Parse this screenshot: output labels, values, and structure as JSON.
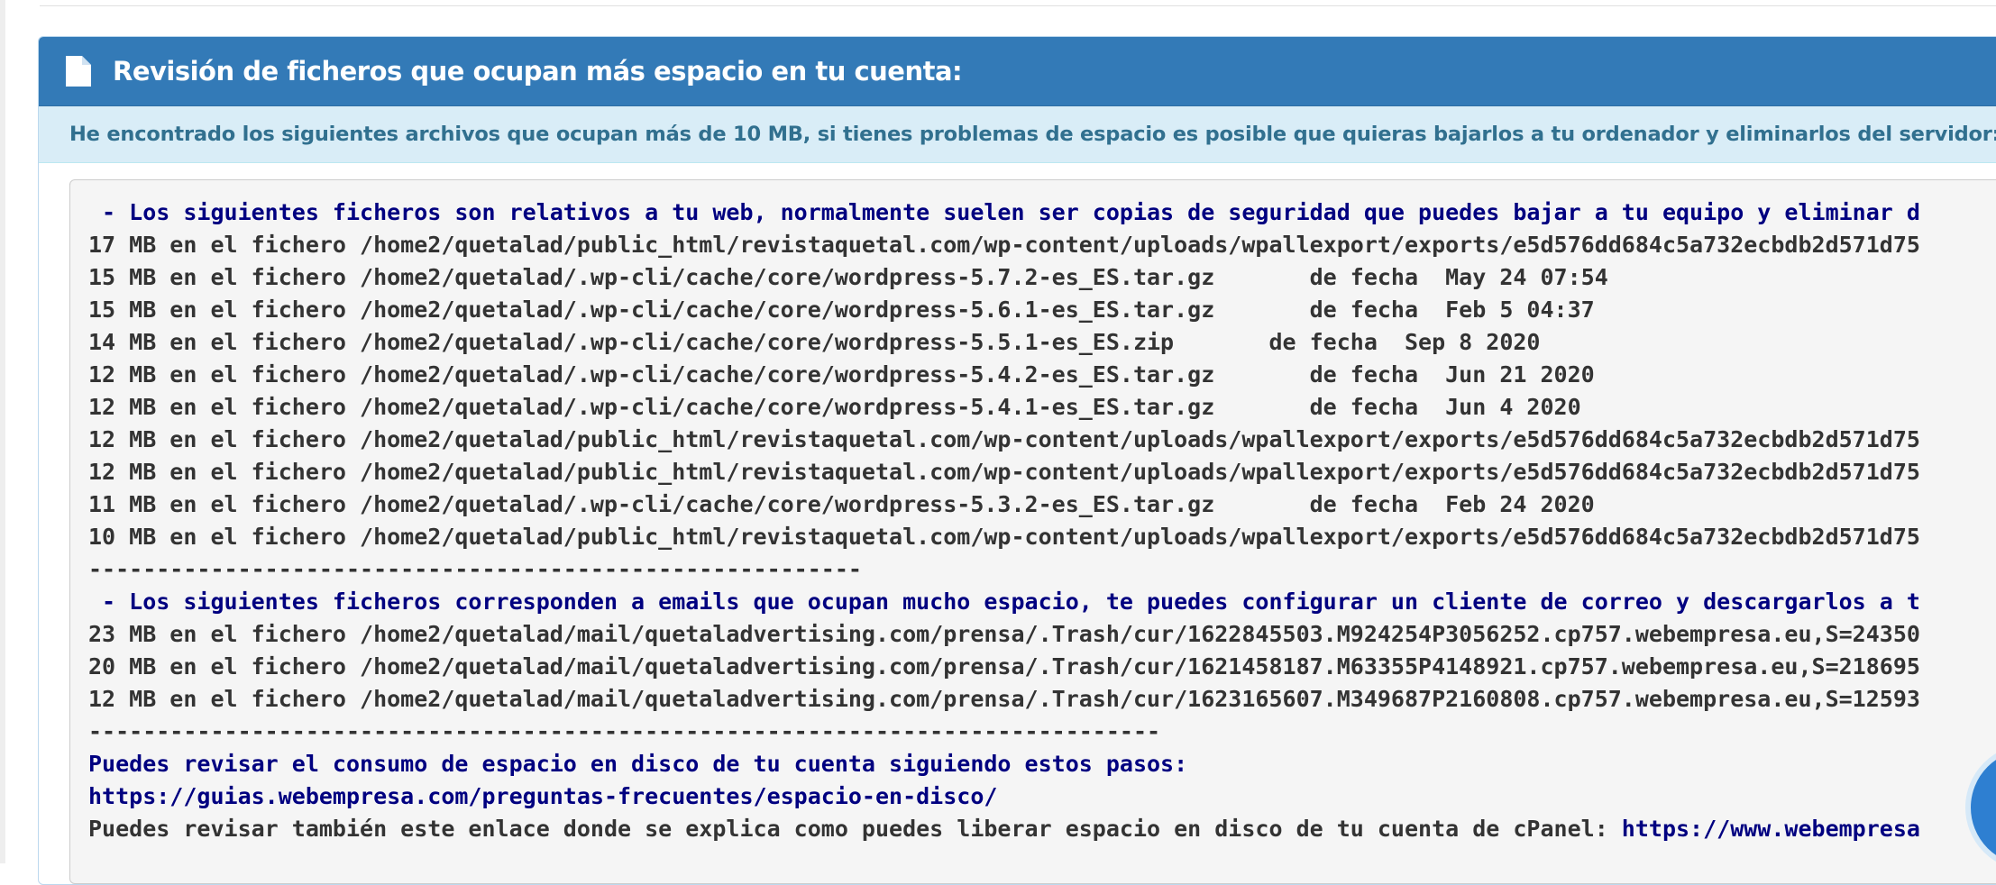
{
  "panel": {
    "title": "Revisión de ficheros que ocupan más espacio en tu cuenta:",
    "icon": "file-icon"
  },
  "notice": {
    "text": "He encontrado los siguientes archivos que ocupan más de 10 MB, si tienes problemas de espacio es posible que quieras bajarlos a tu ordenador y eliminarlos del servidor:"
  },
  "report": {
    "web_heading": " - Los siguientes ficheros son relativos a tu web, normalmente suelen ser copias de seguridad que puedes bajar a tu equipo y eliminar d",
    "web_files": [
      "17 MB en el fichero /home2/quetalad/public_html/revistaquetal.com/wp-content/uploads/wpallexport/exports/e5d576dd684c5a732ecbdb2d571d75",
      "15 MB en el fichero /home2/quetalad/.wp-cli/cache/core/wordpress-5.7.2-es_ES.tar.gz       de fecha  May 24 07:54",
      "15 MB en el fichero /home2/quetalad/.wp-cli/cache/core/wordpress-5.6.1-es_ES.tar.gz       de fecha  Feb 5 04:37",
      "14 MB en el fichero /home2/quetalad/.wp-cli/cache/core/wordpress-5.5.1-es_ES.zip       de fecha  Sep 8 2020",
      "12 MB en el fichero /home2/quetalad/.wp-cli/cache/core/wordpress-5.4.2-es_ES.tar.gz       de fecha  Jun 21 2020",
      "12 MB en el fichero /home2/quetalad/.wp-cli/cache/core/wordpress-5.4.1-es_ES.tar.gz       de fecha  Jun 4 2020",
      "12 MB en el fichero /home2/quetalad/public_html/revistaquetal.com/wp-content/uploads/wpallexport/exports/e5d576dd684c5a732ecbdb2d571d75",
      "12 MB en el fichero /home2/quetalad/public_html/revistaquetal.com/wp-content/uploads/wpallexport/exports/e5d576dd684c5a732ecbdb2d571d75",
      "11 MB en el fichero /home2/quetalad/.wp-cli/cache/core/wordpress-5.3.2-es_ES.tar.gz       de fecha  Feb 24 2020",
      "10 MB en el fichero /home2/quetalad/public_html/revistaquetal.com/wp-content/uploads/wpallexport/exports/e5d576dd684c5a732ecbdb2d571d75"
    ],
    "separator_1": "---------------------------------------------------------",
    "mail_heading": " - Los siguientes ficheros corresponden a emails que ocupan mucho espacio, te puedes configurar un cliente de correo y descargarlos a t",
    "mail_files": [
      "23 MB en el fichero /home2/quetalad/mail/quetaladvertising.com/prensa/.Trash/cur/1622845503.M924254P3056252.cp757.webempresa.eu,S=24350",
      "20 MB en el fichero /home2/quetalad/mail/quetaladvertising.com/prensa/.Trash/cur/1621458187.M63355P4148921.cp757.webempresa.eu,S=218695",
      "12 MB en el fichero /home2/quetalad/mail/quetaladvertising.com/prensa/.Trash/cur/1623165607.M349687P2160808.cp757.webempresa.eu,S=12593"
    ],
    "separator_2": "-------------------------------------------------------------------------------",
    "disk_help_text": "Puedes revisar el consumo de espacio en disco de tu cuenta siguiendo estos pasos:",
    "disk_help_link": "https://guias.webempresa.com/preguntas-frecuentes/espacio-en-disco/",
    "cpanel_help_text": "Puedes revisar también este enlace donde se explica como puedes liberar espacio en disco de tu cuenta de cPanel: ",
    "cpanel_help_link": "https://www.webempresa"
  },
  "colors": {
    "heading_bg": "#337ab7",
    "notice_bg": "#d9edf7",
    "notice_text": "#31708f",
    "pre_bg": "#f5f5f5",
    "navy_text": "#000080"
  }
}
